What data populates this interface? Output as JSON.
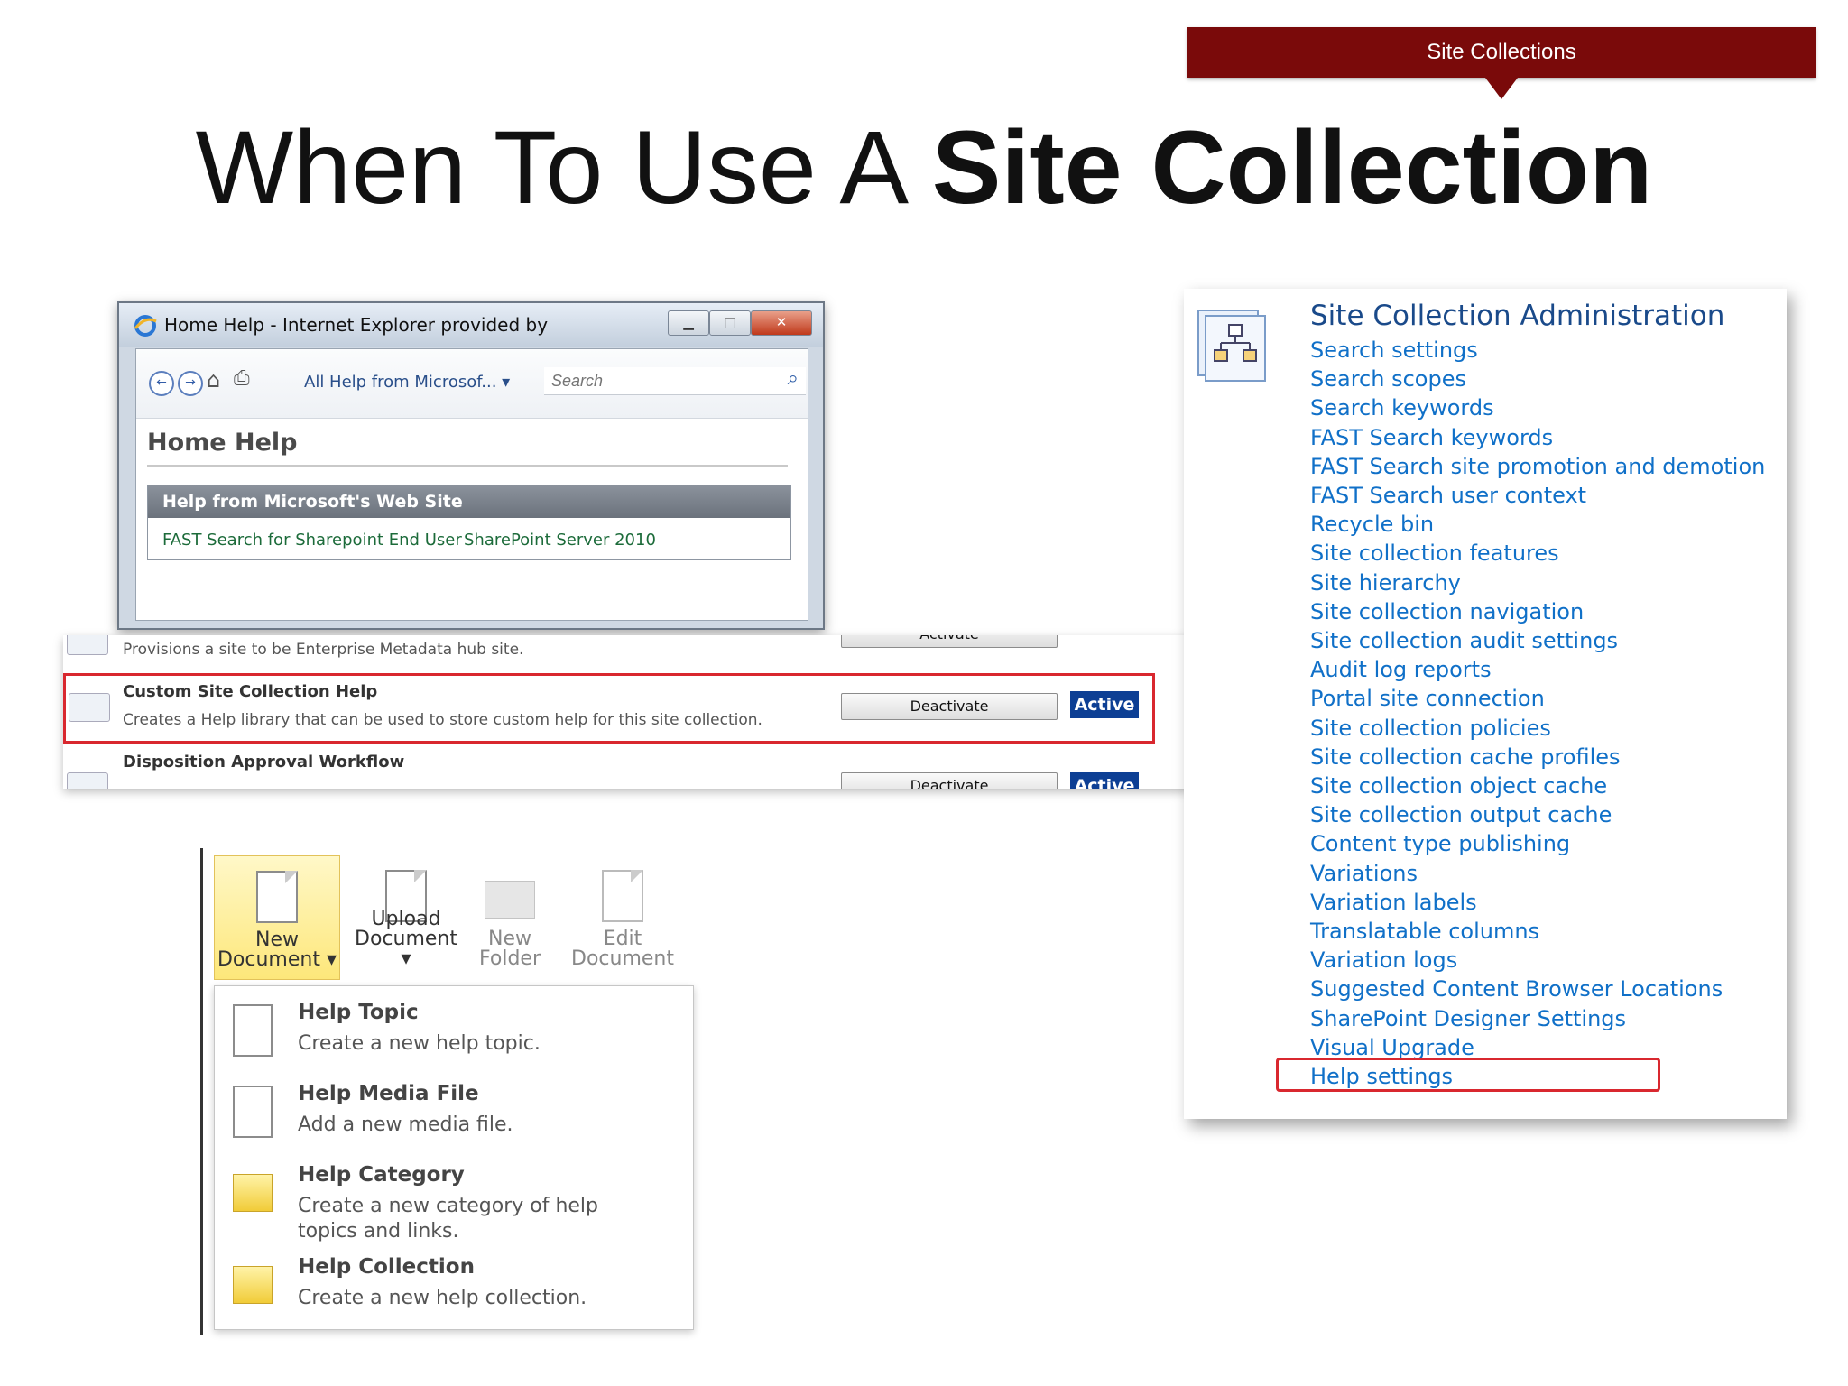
{
  "banner": {
    "label": "Site Collections"
  },
  "slide_title": {
    "regular": "When To Use A ",
    "bold": "Site Collection"
  },
  "ie_window": {
    "title": "Home Help - Internet Explorer provided by",
    "search_scope": "All Help from Microsof...",
    "search_placeholder": "Search",
    "page_heading": "Home Help",
    "help_section": {
      "heading": "Help from Microsoft's Web Site",
      "links": [
        "FAST Search for Sharepoint End User",
        "SharePoint Server 2010"
      ]
    }
  },
  "features": {
    "rows": [
      {
        "title": "",
        "description": "Provisions a site to be Enterprise Metadata hub site.",
        "button": "Activate",
        "status": ""
      },
      {
        "title": "Custom Site Collection Help",
        "description": "Creates a Help library that can be used to store custom help for this site collection.",
        "button": "Deactivate",
        "status": "Active"
      },
      {
        "title": "Disposition Approval Workflow",
        "description": "",
        "button": "Deactivate",
        "status": "Active"
      }
    ]
  },
  "ribbon": {
    "buttons": [
      {
        "line1": "New",
        "line2": "Document"
      },
      {
        "line1": "Upload",
        "line2": "Document"
      },
      {
        "line1": "New",
        "line2": "Folder"
      },
      {
        "line1": "Edit",
        "line2": "Document"
      }
    ],
    "menu_items": [
      {
        "title": "Help Topic",
        "description": "Create a new help topic."
      },
      {
        "title": "Help Media File",
        "description": "Add a new media file."
      },
      {
        "title": "Help Category",
        "description": "Create a new category of help topics and links."
      },
      {
        "title": "Help Collection",
        "description": "Create a new help collection."
      }
    ]
  },
  "admin": {
    "title": "Site Collection Administration",
    "links": [
      "Search settings",
      "Search scopes",
      "Search keywords",
      "FAST Search keywords",
      "FAST Search site promotion and demotion",
      "FAST Search user context",
      "Recycle bin",
      "Site collection features",
      "Site hierarchy",
      "Site collection navigation",
      "Site collection audit settings",
      "Audit log reports",
      "Portal site connection",
      "Site collection policies",
      "Site collection cache profiles",
      "Site collection object cache",
      "Site collection output cache",
      "Content type publishing",
      "Variations",
      "Variation labels",
      "Translatable columns",
      "Variation logs",
      "Suggested Content Browser Locations",
      "SharePoint Designer Settings",
      "Visual Upgrade",
      "Help settings"
    ]
  },
  "colors": {
    "banner": "#7a0a0a",
    "link": "#1070c8",
    "highlight": "#d9282f",
    "active_badge": "#0d3f94"
  }
}
